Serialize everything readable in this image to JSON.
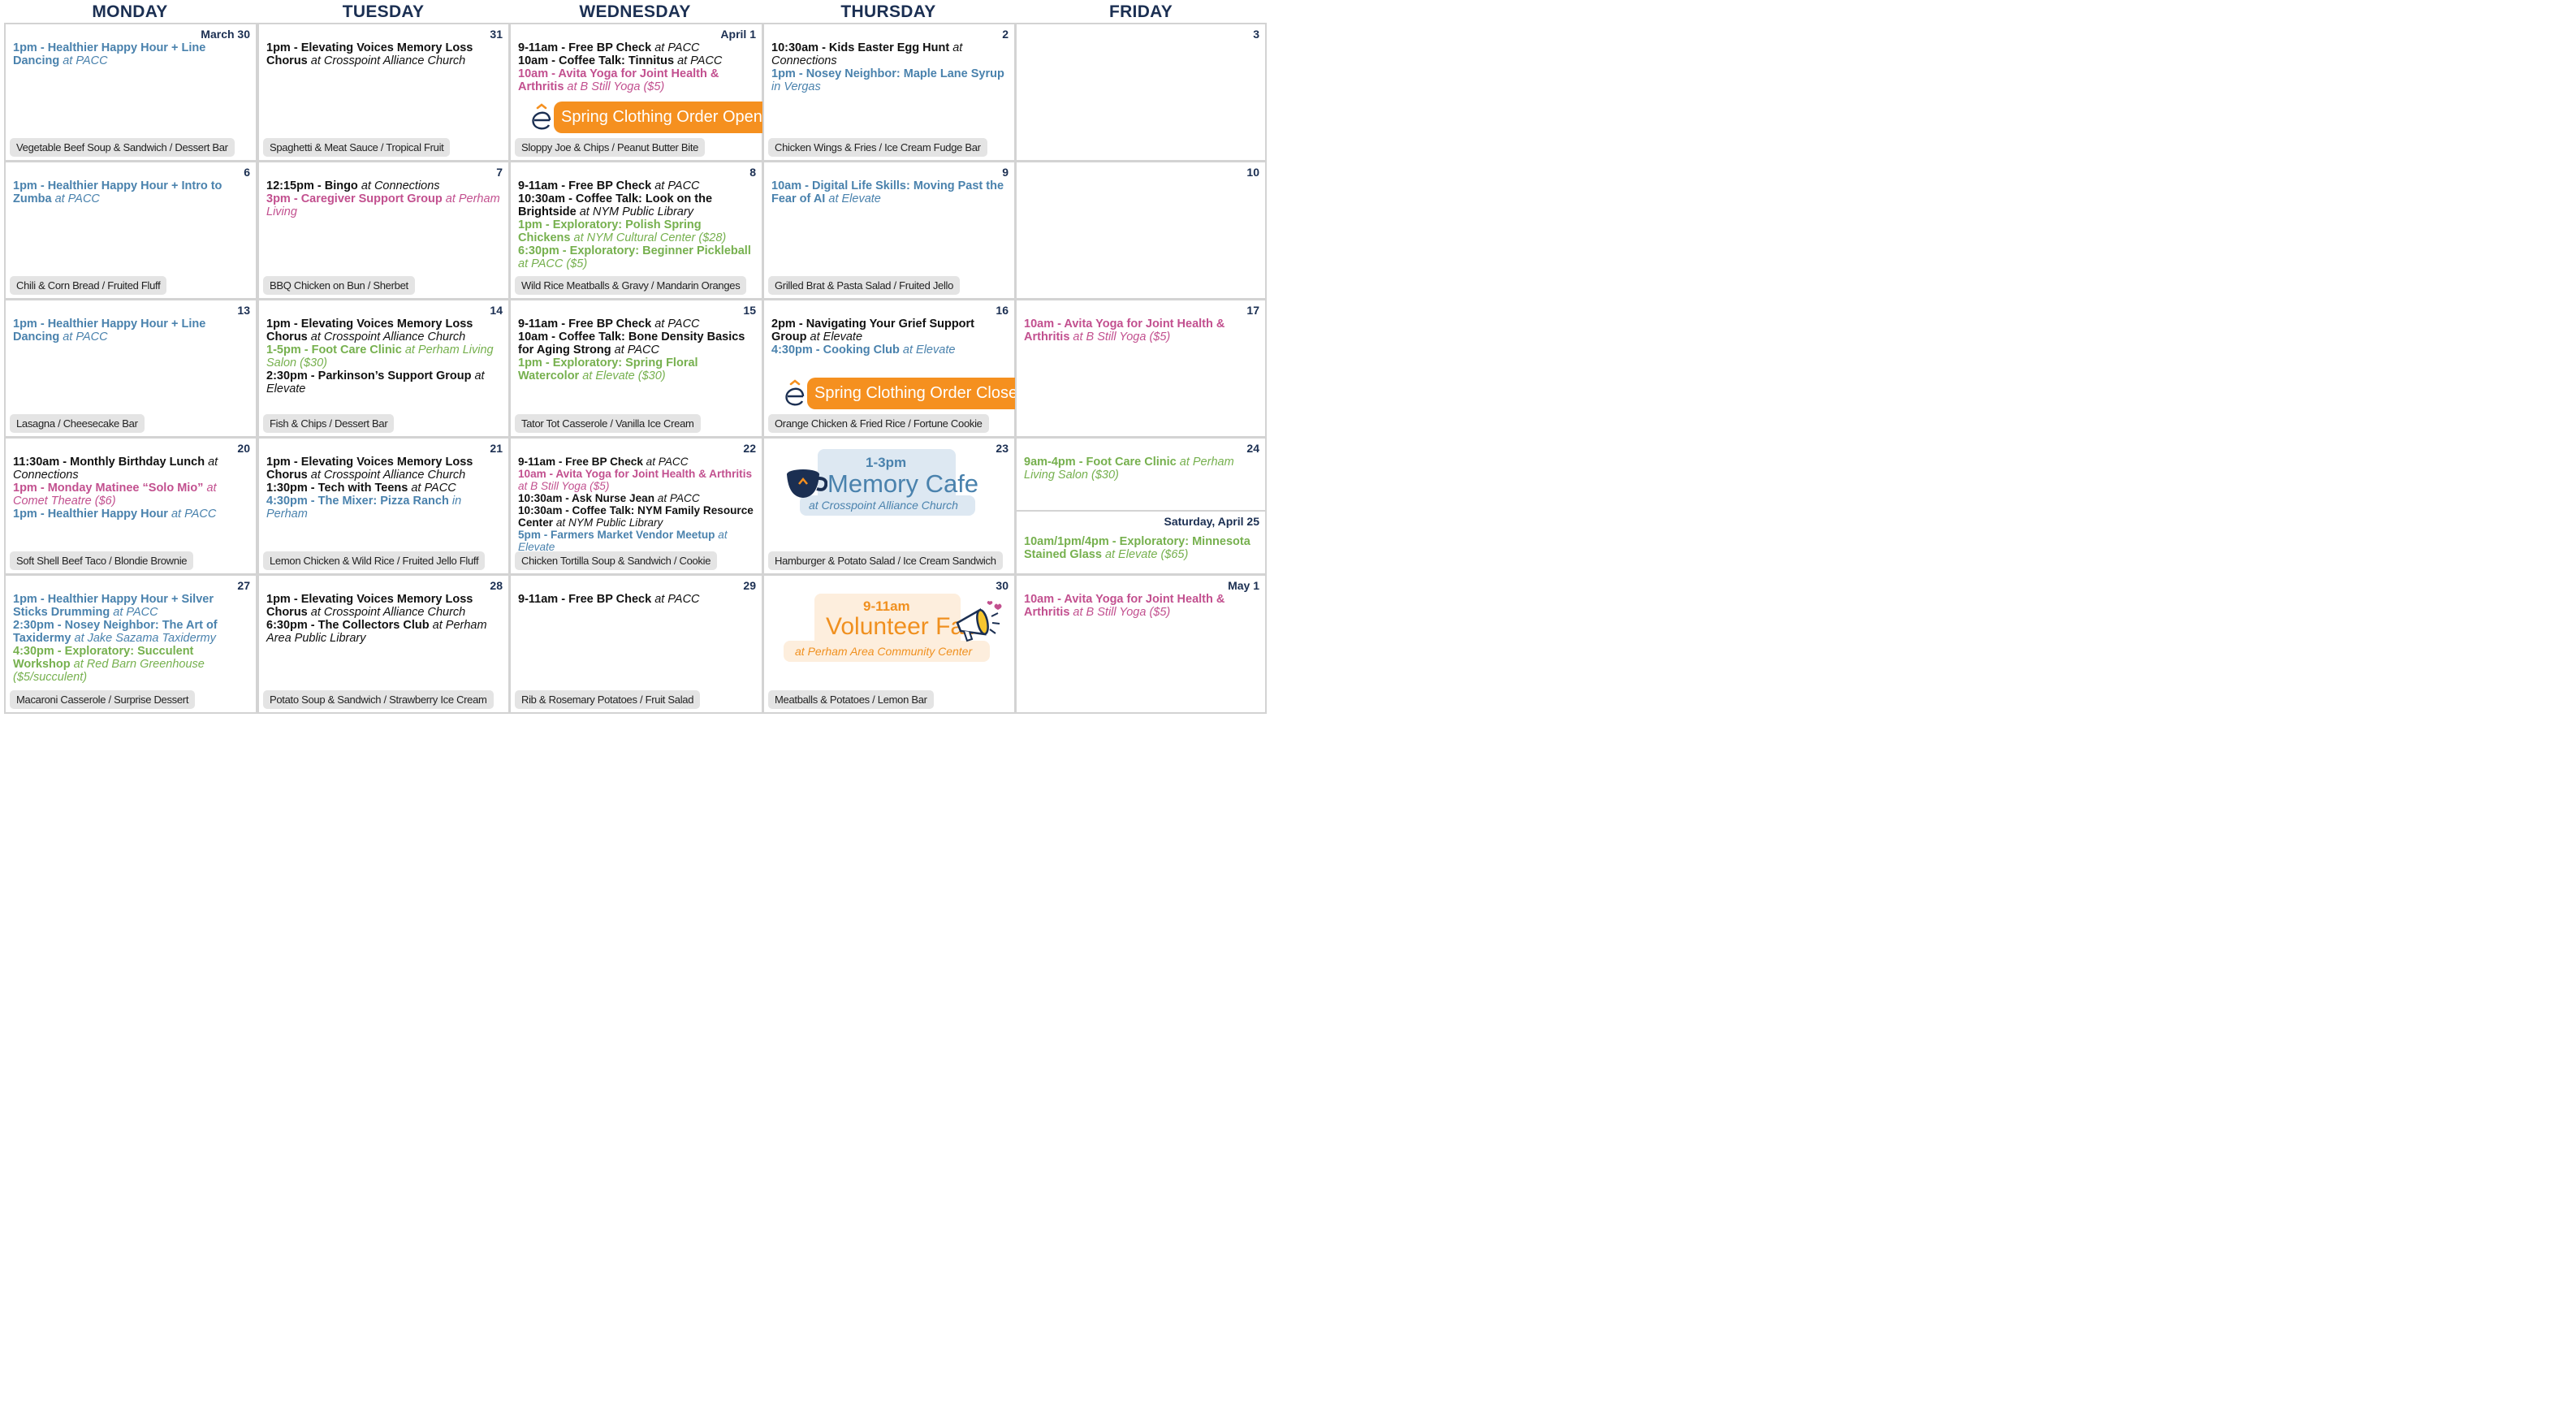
{
  "days": [
    "MONDAY",
    "TUESDAY",
    "WEDNESDAY",
    "THURSDAY",
    "FRIDAY"
  ],
  "cells": [
    {
      "date": "March 30",
      "events": [
        {
          "c": "blue",
          "parts": [
            {
              "t": "b",
              "v": "1pm - Healthier Happy Hour + Line Dancing "
            },
            {
              "t": "i",
              "v": "at PACC"
            }
          ]
        }
      ],
      "menu": "Vegetable Beef Soup & Sandwich / Dessert Bar"
    },
    {
      "date": "31",
      "events": [
        {
          "c": "black",
          "parts": [
            {
              "t": "b",
              "v": "1pm - Elevating Voices Memory Loss Chorus "
            },
            {
              "t": "i",
              "v": "at Crosspoint Alliance Church"
            }
          ]
        }
      ],
      "menu": "Spaghetti & Meat Sauce / Tropical Fruit"
    },
    {
      "date": "April 1",
      "events": [
        {
          "c": "black",
          "parts": [
            {
              "t": "b",
              "v": "9-11am - Free BP Check "
            },
            {
              "t": "i",
              "v": "at PACC"
            }
          ]
        },
        {
          "c": "black",
          "parts": [
            {
              "t": "b",
              "v": "10am - Coffee Talk: Tinnitus "
            },
            {
              "t": "i",
              "v": "at PACC"
            }
          ]
        },
        {
          "c": "pink",
          "parts": [
            {
              "t": "b",
              "v": "10am - Avita Yoga for Joint Health & Arthritis "
            },
            {
              "t": "i",
              "v": "at B Still Yoga ($5)"
            }
          ]
        }
      ],
      "menu": "Sloppy Joe & Chips / Peanut Butter Bite",
      "banner": "Spring Clothing Order Opens"
    },
    {
      "date": "2",
      "events": [
        {
          "c": "black",
          "parts": [
            {
              "t": "b",
              "v": "10:30am - Kids Easter Egg Hunt "
            },
            {
              "t": "i",
              "v": "at Connections"
            }
          ]
        },
        {
          "c": "blue",
          "parts": [
            {
              "t": "b",
              "v": "1pm - Nosey Neighbor: Maple Lane Syrup "
            },
            {
              "t": "i",
              "v": "in Vergas"
            }
          ]
        }
      ],
      "menu": "Chicken Wings & Fries / Ice Cream Fudge Bar"
    },
    {
      "date": "3",
      "events": []
    },
    {
      "date": "6",
      "events": [
        {
          "c": "blue",
          "parts": [
            {
              "t": "b",
              "v": "1pm - Healthier Happy Hour + Intro to Zumba "
            },
            {
              "t": "i",
              "v": "at PACC"
            }
          ]
        }
      ],
      "menu": "Chili & Corn Bread / Fruited Fluff"
    },
    {
      "date": "7",
      "events": [
        {
          "c": "black",
          "parts": [
            {
              "t": "b",
              "v": "12:15pm - Bingo "
            },
            {
              "t": "i",
              "v": "at Connections"
            }
          ]
        },
        {
          "c": "pink",
          "parts": [
            {
              "t": "b",
              "v": "3pm - Caregiver Support Group "
            },
            {
              "t": "i",
              "v": "at Perham Living"
            }
          ]
        }
      ],
      "menu": "BBQ Chicken on Bun / Sherbet"
    },
    {
      "date": "8",
      "events": [
        {
          "c": "black",
          "parts": [
            {
              "t": "b",
              "v": "9-11am - Free BP Check "
            },
            {
              "t": "i",
              "v": "at PACC"
            }
          ]
        },
        {
          "c": "black",
          "parts": [
            {
              "t": "b",
              "v": "10:30am - Coffee Talk: Look on the Brightside "
            },
            {
              "t": "i",
              "v": "at NYM Public Library"
            }
          ]
        },
        {
          "c": "green",
          "parts": [
            {
              "t": "b",
              "v": "1pm - Exploratory: Polish Spring Chickens "
            },
            {
              "t": "i",
              "v": "at NYM Cultural Center ($28)"
            }
          ]
        },
        {
          "c": "green",
          "parts": [
            {
              "t": "b",
              "v": "6:30pm - Exploratory: Beginner Pickleball "
            },
            {
              "t": "i",
              "v": "at PACC ($5)"
            }
          ]
        }
      ],
      "menu": "Wild Rice Meatballs & Gravy / Mandarin Oranges"
    },
    {
      "date": "9",
      "events": [
        {
          "c": "blue",
          "parts": [
            {
              "t": "b",
              "v": "10am - Digital Life Skills: Moving Past the Fear of AI "
            },
            {
              "t": "i",
              "v": "at Elevate"
            }
          ]
        }
      ],
      "menu": "Grilled Brat & Pasta Salad / Fruited Jello"
    },
    {
      "date": "10",
      "events": []
    },
    {
      "date": "13",
      "events": [
        {
          "c": "blue",
          "parts": [
            {
              "t": "b",
              "v": "1pm - Healthier Happy Hour + Line Dancing "
            },
            {
              "t": "i",
              "v": "at PACC"
            }
          ]
        }
      ],
      "menu": "Lasagna / Cheesecake Bar"
    },
    {
      "date": "14",
      "events": [
        {
          "c": "black",
          "parts": [
            {
              "t": "b",
              "v": "1pm - Elevating Voices Memory Loss Chorus "
            },
            {
              "t": "i",
              "v": "at Crosspoint Alliance Church"
            }
          ]
        },
        {
          "c": "green",
          "parts": [
            {
              "t": "b",
              "v": "1-5pm - Foot Care Clinic "
            },
            {
              "t": "i",
              "v": "at Perham Living Salon ($30)"
            }
          ]
        },
        {
          "c": "black",
          "parts": [
            {
              "t": "b",
              "v": "2:30pm - Parkinson’s Support Group "
            },
            {
              "t": "i",
              "v": "at Elevate"
            }
          ]
        }
      ],
      "menu": "Fish & Chips / Dessert Bar"
    },
    {
      "date": "15",
      "events": [
        {
          "c": "black",
          "parts": [
            {
              "t": "b",
              "v": "9-11am - Free BP Check "
            },
            {
              "t": "i",
              "v": "at PACC"
            }
          ]
        },
        {
          "c": "black",
          "parts": [
            {
              "t": "b",
              "v": "10am - Coffee Talk: Bone Density Basics for Aging Strong "
            },
            {
              "t": "i",
              "v": "at PACC"
            }
          ]
        },
        {
          "c": "green",
          "parts": [
            {
              "t": "b",
              "v": "1pm - Exploratory: Spring Floral Watercolor "
            },
            {
              "t": "i",
              "v": "at Elevate ($30)"
            }
          ]
        }
      ],
      "menu": "Tator Tot Casserole / Vanilla Ice Cream"
    },
    {
      "date": "16",
      "events": [
        {
          "c": "black",
          "parts": [
            {
              "t": "b",
              "v": "2pm - Navigating Your Grief Support Group "
            },
            {
              "t": "i",
              "v": "at Elevate"
            }
          ]
        },
        {
          "c": "blue",
          "parts": [
            {
              "t": "b",
              "v": "4:30pm - Cooking Club "
            },
            {
              "t": "i",
              "v": "at Elevate"
            }
          ]
        }
      ],
      "menu": "Orange Chicken & Fried Rice / Fortune Cookie",
      "banner": "Spring Clothing Order Closes"
    },
    {
      "date": "17",
      "events": [
        {
          "c": "pink",
          "parts": [
            {
              "t": "b",
              "v": "10am - Avita Yoga for Joint Health & Arthritis "
            },
            {
              "t": "i",
              "v": "at B Still Yoga ($5)"
            }
          ]
        }
      ]
    },
    {
      "date": "20",
      "events": [
        {
          "c": "black",
          "parts": [
            {
              "t": "b",
              "v": "11:30am - Monthly Birthday Lunch "
            },
            {
              "t": "i",
              "v": "at Connections"
            }
          ]
        },
        {
          "c": "pink",
          "parts": [
            {
              "t": "b",
              "v": "1pm - Monday Matinee “Solo Mio” "
            },
            {
              "t": "i",
              "v": "at Comet Theatre ($6)"
            }
          ]
        },
        {
          "c": "blue",
          "parts": [
            {
              "t": "b",
              "v": "1pm - Healthier Happy Hour "
            },
            {
              "t": "i",
              "v": "at PACC"
            }
          ]
        }
      ],
      "menu": "Soft Shell Beef Taco / Blondie Brownie"
    },
    {
      "date": "21",
      "events": [
        {
          "c": "black",
          "parts": [
            {
              "t": "b",
              "v": "1pm - Elevating Voices Memory Loss Chorus "
            },
            {
              "t": "i",
              "v": "at Crosspoint Alliance Church"
            }
          ]
        },
        {
          "c": "black",
          "parts": [
            {
              "t": "b",
              "v": "1:30pm - Tech with Teens "
            },
            {
              "t": "i",
              "v": "at PACC"
            }
          ]
        },
        {
          "c": "blue",
          "parts": [
            {
              "t": "b",
              "v": "4:30pm - The Mixer: Pizza Ranch "
            },
            {
              "t": "i",
              "v": "in Perham"
            }
          ]
        }
      ],
      "menu": "Lemon Chicken & Wild Rice / Fruited Jello Fluff"
    },
    {
      "date": "22",
      "small": true,
      "events": [
        {
          "c": "black",
          "parts": [
            {
              "t": "b",
              "v": "9-11am - Free BP Check "
            },
            {
              "t": "i",
              "v": "at PACC"
            }
          ]
        },
        {
          "c": "pink",
          "parts": [
            {
              "t": "b",
              "v": "10am - Avita Yoga for Joint Health & Arthritis "
            },
            {
              "t": "i",
              "v": "at B Still Yoga ($5)"
            }
          ]
        },
        {
          "c": "black",
          "parts": [
            {
              "t": "b",
              "v": "10:30am - Ask Nurse Jean "
            },
            {
              "t": "i",
              "v": "at PACC"
            }
          ]
        },
        {
          "c": "black",
          "parts": [
            {
              "t": "b",
              "v": "10:30am - Coffee Talk: NYM Family Resource Center "
            },
            {
              "t": "i",
              "v": "at NYM Public Library"
            }
          ]
        },
        {
          "c": "blue",
          "parts": [
            {
              "t": "b",
              "v": "5pm - Farmers Market Vendor Meetup "
            },
            {
              "t": "i",
              "v": "at Elevate"
            }
          ]
        }
      ],
      "menu": "Chicken Tortilla Soup & Sandwich / Cookie"
    },
    {
      "date": "23",
      "events": [],
      "menu": "Hamburger & Potato Salad / Ice Cream Sandwich",
      "memory_cafe": {
        "time": "1-3pm",
        "title": "Memory Cafe",
        "location": "at Crosspoint Alliance Church"
      }
    },
    {
      "date": "24",
      "events": [
        {
          "c": "green",
          "parts": [
            {
              "t": "b",
              "v": "9am-4pm - Foot Care Clinic "
            },
            {
              "t": "i",
              "v": "at Perham Living Salon ($30)"
            }
          ]
        }
      ],
      "saturday": {
        "heading": "Saturday, April 25",
        "events": [
          {
            "c": "green",
            "parts": [
              {
                "t": "b",
                "v": "10am/1pm/4pm - Exploratory: Minnesota Stained Glass "
              },
              {
                "t": "i",
                "v": "at Elevate ($65)"
              }
            ]
          }
        ]
      }
    },
    {
      "date": "27",
      "events": [
        {
          "c": "blue",
          "parts": [
            {
              "t": "b",
              "v": "1pm - Healthier Happy Hour + Silver Sticks Drumming "
            },
            {
              "t": "i",
              "v": "at PACC"
            }
          ]
        },
        {
          "c": "blue",
          "parts": [
            {
              "t": "b",
              "v": "2:30pm - Nosey Neighbor: The Art of Taxidermy "
            },
            {
              "t": "i",
              "v": "at Jake Sazama Taxidermy"
            }
          ]
        },
        {
          "c": "green",
          "parts": [
            {
              "t": "b",
              "v": "4:30pm - Exploratory: Succulent Workshop "
            },
            {
              "t": "i",
              "v": "at Red Barn Greenhouse ($5/succulent)"
            }
          ]
        }
      ],
      "menu": "Macaroni Casserole / Surprise Dessert"
    },
    {
      "date": "28",
      "events": [
        {
          "c": "black",
          "parts": [
            {
              "t": "b",
              "v": "1pm - Elevating Voices Memory Loss Chorus "
            },
            {
              "t": "i",
              "v": "at Crosspoint Alliance Church"
            }
          ]
        },
        {
          "c": "black",
          "parts": [
            {
              "t": "b",
              "v": "6:30pm - The Collectors Club "
            },
            {
              "t": "i",
              "v": "at Perham Area Public Library"
            }
          ]
        }
      ],
      "menu": "Potato Soup & Sandwich / Strawberry Ice Cream"
    },
    {
      "date": "29",
      "events": [
        {
          "c": "black",
          "parts": [
            {
              "t": "b",
              "v": "9-11am - Free BP Check "
            },
            {
              "t": "i",
              "v": "at PACC"
            }
          ]
        }
      ],
      "menu": "Rib & Rosemary Potatoes / Fruit Salad"
    },
    {
      "date": "30",
      "events": [],
      "menu": "Meatballs & Potatoes / Lemon Bar",
      "volunteer_fair": {
        "time": "9-11am",
        "title": "Volunteer Fair",
        "location": "at Perham Area Community Center"
      }
    },
    {
      "date": "May 1",
      "events": [
        {
          "c": "pink",
          "parts": [
            {
              "t": "b",
              "v": "10am - Avita Yoga for Joint Health & Arthritis "
            },
            {
              "t": "i",
              "v": "at B Still Yoga ($5)"
            }
          ]
        }
      ]
    }
  ]
}
